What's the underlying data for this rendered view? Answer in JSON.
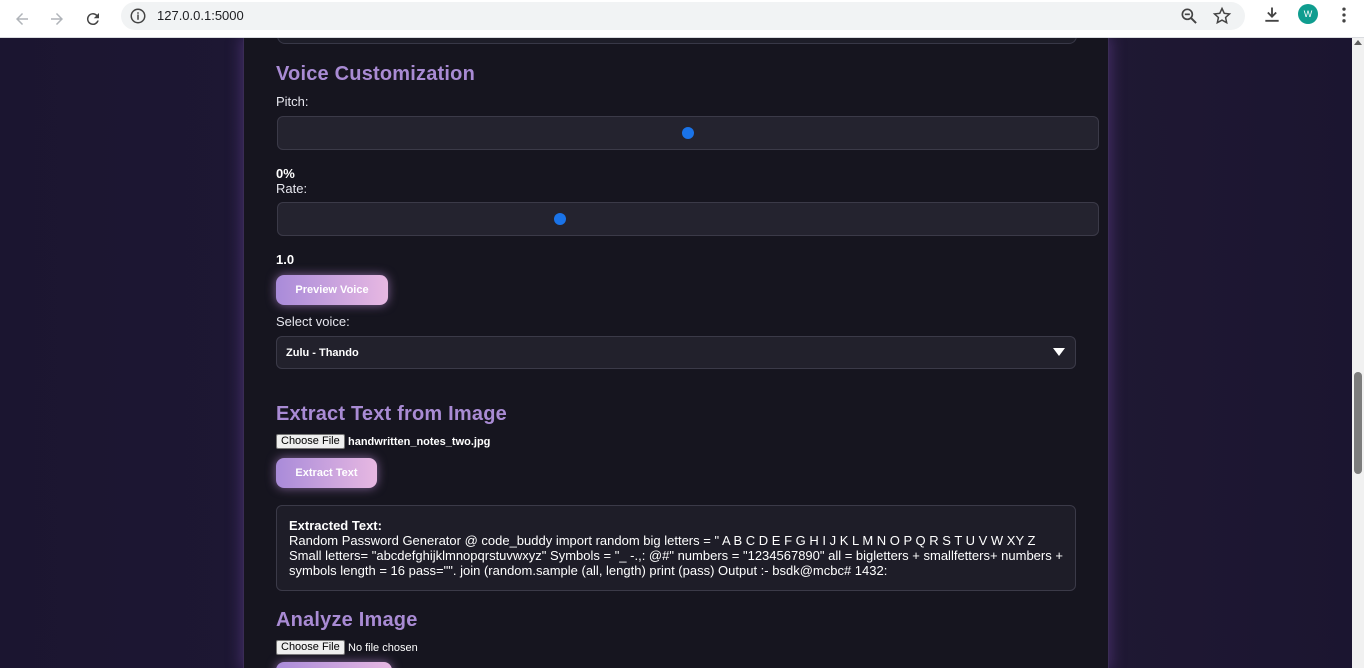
{
  "browser": {
    "url": "127.0.0.1:5000",
    "profile_initial": "W",
    "icons": [
      "back-icon",
      "forward-icon",
      "reload-icon",
      "info-icon",
      "zoom-icon",
      "star-icon",
      "download-icon",
      "menu-icon"
    ]
  },
  "voice": {
    "heading": "Voice Customization",
    "pitch_label": "Pitch:",
    "pitch_value": "0%",
    "pitch_fraction": 0.5,
    "rate_label": "Rate:",
    "rate_value": "1.0",
    "rate_fraction": 0.34,
    "preview_button": "Preview Voice",
    "select_label": "Select voice:",
    "selected_voice": "Zulu - Thando"
  },
  "extract": {
    "heading": "Extract Text from Image",
    "choose_file": "Choose File",
    "file_name": "handwritten_notes_two.jpg",
    "button": "Extract Text",
    "result_title": "Extracted Text:",
    "result_text": "Random Password Generator @ code_buddy import random big letters = \" A B C D E F G H I J K L M N O P Q R S T U V W XY Z Small letters= \"abcdefghijklmnopqrstuvwxyz\" Symbols = \"_ -.,: @#\" numbers = \"1234567890\" all = bigletters + smallfetters+ numbers + symbols length = 16 pass=\"\". join (random.sample (all, length) print (pass) Output :- bsdk@mcbc# 1432:"
  },
  "analyze": {
    "heading": "Analyze Image",
    "choose_file": "Choose File",
    "file_name": "No file chosen"
  },
  "colors": {
    "accent": "#a98bd4",
    "slider_thumb": "#1a73e8",
    "button_start": "#a98bd9",
    "button_end": "#e7b8e2"
  }
}
